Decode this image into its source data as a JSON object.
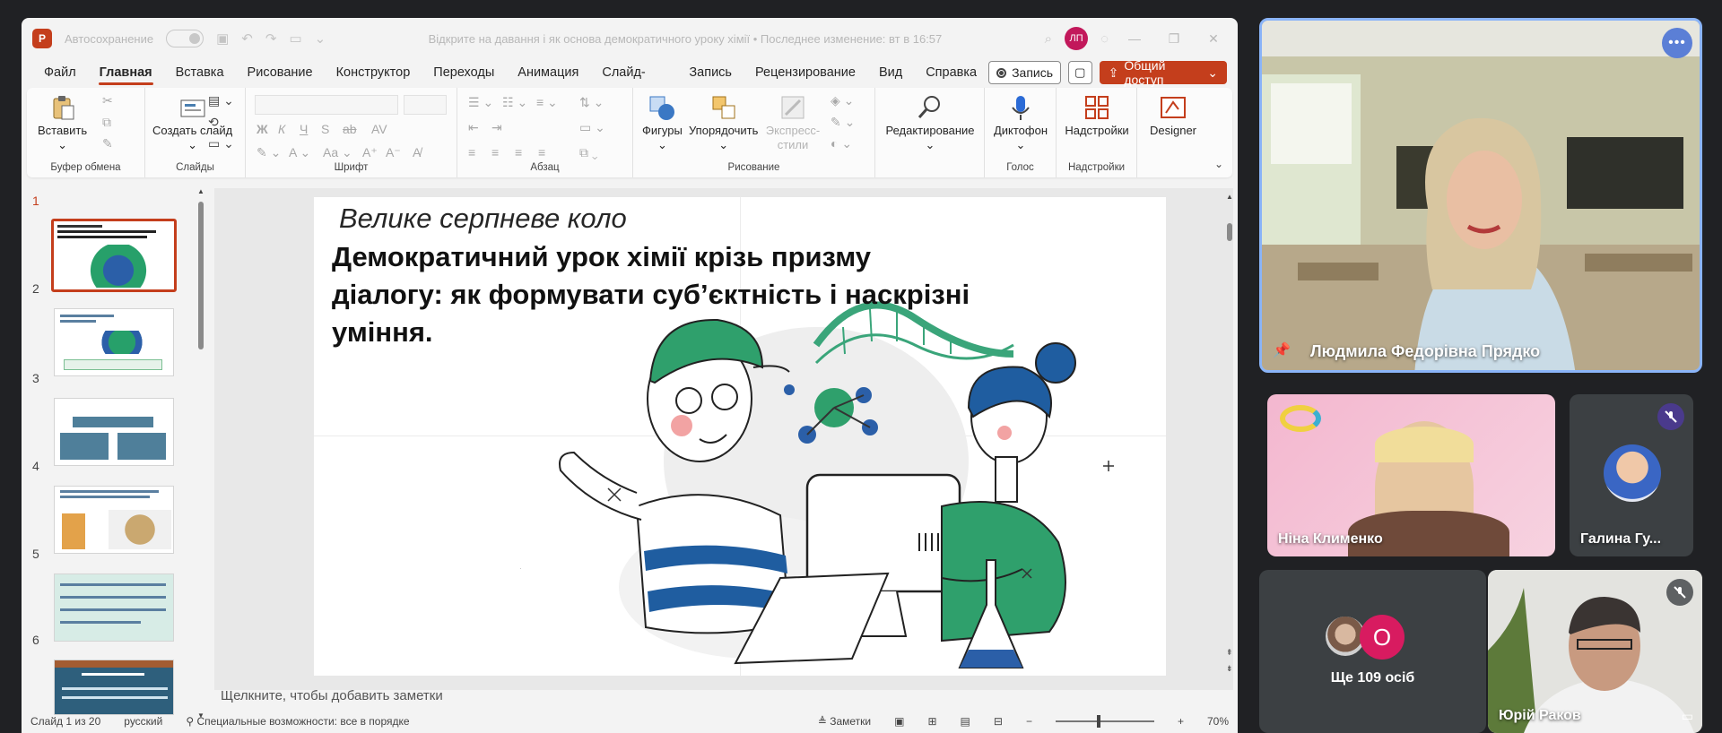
{
  "powerpoint": {
    "autosave_label": "Автосохранение",
    "doc_title": "Відкрите на давання і як основа демократичного уроку хімії • Последнее изменение: вт в 16:57",
    "user_initials": "ЛП",
    "menu": [
      "Файл",
      "Главная",
      "Вставка",
      "Рисование",
      "Конструктор",
      "Переходы",
      "Анимация",
      "Слайд-шоу",
      "Запись",
      "Рецензирование",
      "Вид",
      "Справка"
    ],
    "record_label": "Запись",
    "share_label": "Общий доступ",
    "ribbon": {
      "paste": "Вставить",
      "new_slide": "Создать слайд",
      "shapes": "Фигуры",
      "arrange": "Упорядочить",
      "quick_styles": "Экспресс-стили",
      "editing": "Редактирование",
      "dictate": "Диктофон",
      "addins": "Надстройки",
      "designer": "Designer",
      "groups": {
        "clipboard": "Буфер обмена",
        "slides": "Слайды",
        "font": "Шрифт",
        "paragraph": "Абзац",
        "drawing": "Рисование",
        "voice": "Голос",
        "addins": "Надстройки"
      },
      "font_buttons": [
        "Ж",
        "К",
        "Ч",
        "S",
        "ab",
        "AV"
      ]
    },
    "thumbnails": [
      "1",
      "2",
      "3",
      "4",
      "5",
      "6"
    ],
    "slide": {
      "subtitle": "Велике серпневе коло",
      "title": "Демократичний урок хімії крізь призму діалогу: як формувати суб’єктність і наскрізні уміння."
    },
    "notes_placeholder": "Щелкните, чтобы добавить заметки",
    "status": {
      "slide_counter": "Слайд 1 из 20",
      "language": "русский",
      "accessibility": "Специальные возможности: все в порядке",
      "notes": "Заметки",
      "zoom": "70%"
    }
  },
  "meeting": {
    "speaker_name": "Людмила Федорівна Прядко",
    "participants": [
      {
        "name": "Ніна Клименко"
      },
      {
        "name": "Галина Гу..."
      },
      {
        "name": "Юрій Раков"
      }
    ],
    "others_count_label": "Ще 109 осіб",
    "others_avatar_letter": "О",
    "colors": {
      "speaker_border": "#8ab4f8",
      "ppt_accent": "#c43e1c",
      "avatar_o": "#d81b60"
    }
  }
}
